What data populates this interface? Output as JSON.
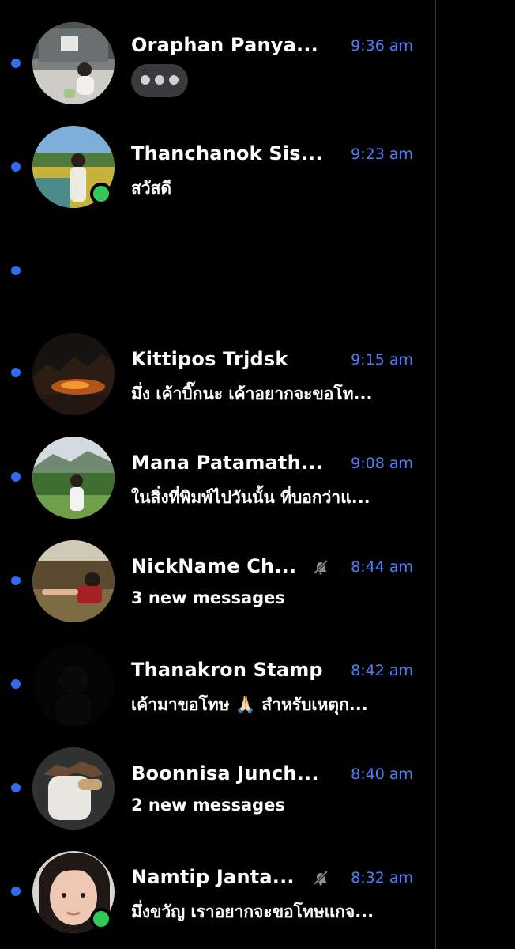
{
  "colors": {
    "background": "#000000",
    "unread_dot": "#2f6cf6",
    "time_text": "#4f7ff7",
    "online_indicator": "#34c759",
    "typing_bubble": "#3a3a3c"
  },
  "conversations": [
    {
      "name": "Oraphan Panya...",
      "time": "9:36 am",
      "preview": "",
      "typing": true,
      "unread": true,
      "online": false,
      "muted": false
    },
    {
      "name": "Thanchanok Sis...",
      "time": "9:23 am",
      "preview": "สวัสดี",
      "typing": false,
      "unread": true,
      "online": true,
      "muted": false
    },
    {
      "name": "",
      "time": "",
      "preview": "",
      "typing": false,
      "unread": true,
      "online": false,
      "muted": false
    },
    {
      "name": "Kittipos Trjdsk",
      "time": "9:15 am",
      "preview": "มึ่ง เค้าบิ๊กนะ เค้าอยากจะขอโท...",
      "typing": false,
      "unread": true,
      "online": false,
      "muted": false
    },
    {
      "name": "Mana Patamath...",
      "time": "9:08 am",
      "preview": "ในสิ่งที่พิมพ์ไปวันนั้น ที่บอกว่าแ...",
      "typing": false,
      "unread": true,
      "online": false,
      "muted": false
    },
    {
      "name": "NickName Ch...",
      "time": "8:44 am",
      "preview": "3 new messages",
      "typing": false,
      "unread": true,
      "online": false,
      "muted": true
    },
    {
      "name": "Thanakron Stamp",
      "time": "8:42 am",
      "preview": "เค้ามาขอโทษ 🙏🏻 สำหรับเหตุก...",
      "typing": false,
      "unread": true,
      "online": false,
      "muted": false
    },
    {
      "name": "Boonnisa Junch...",
      "time": "8:40 am",
      "preview": "2 new messages",
      "typing": false,
      "unread": true,
      "online": false,
      "muted": false
    },
    {
      "name": "Namtip Janta...",
      "time": "8:32 am",
      "preview": "มึ่งขวัญ เราอยากจะขอโทษแกจ...",
      "typing": false,
      "unread": true,
      "online": true,
      "muted": true
    }
  ]
}
